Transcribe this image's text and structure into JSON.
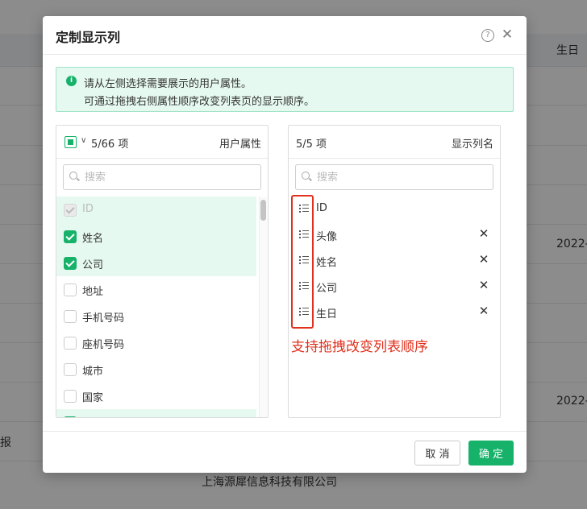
{
  "background": {
    "header_cell": "生日",
    "cells": [
      "2022-",
      "2022-",
      "报",
      "上海源犀信息科技有限公司"
    ]
  },
  "dialog": {
    "title": "定制显示列",
    "notice": {
      "line1": "请从左侧选择需要展示的用户属性。",
      "line2": "可通过拖拽右侧属性顺序改变列表页的显示顺序。"
    },
    "left_panel": {
      "count": "5/66 项",
      "title": "用户属性",
      "search_placeholder": "搜索",
      "items": [
        {
          "label": "ID",
          "checked": true,
          "disabled": true
        },
        {
          "label": "姓名",
          "checked": true,
          "disabled": false
        },
        {
          "label": "公司",
          "checked": true,
          "disabled": false
        },
        {
          "label": "地址",
          "checked": false,
          "disabled": false
        },
        {
          "label": "手机号码",
          "checked": false,
          "disabled": false
        },
        {
          "label": "座机号码",
          "checked": false,
          "disabled": false
        },
        {
          "label": "城市",
          "checked": false,
          "disabled": false
        },
        {
          "label": "国家",
          "checked": false,
          "disabled": false
        }
      ]
    },
    "right_panel": {
      "count": "5/5 项",
      "title": "显示列名",
      "search_placeholder": "搜索",
      "items": [
        {
          "label": "ID",
          "removable": false
        },
        {
          "label": "头像",
          "removable": true
        },
        {
          "label": "姓名",
          "removable": true
        },
        {
          "label": "公司",
          "removable": true
        },
        {
          "label": "生日",
          "removable": true
        }
      ]
    },
    "drag_hint": "支持拖拽改变列表顺序",
    "footer": {
      "cancel": "取 消",
      "ok": "确 定"
    }
  },
  "colors": {
    "accent": "#17b26a",
    "annotation": "#e0311e"
  }
}
